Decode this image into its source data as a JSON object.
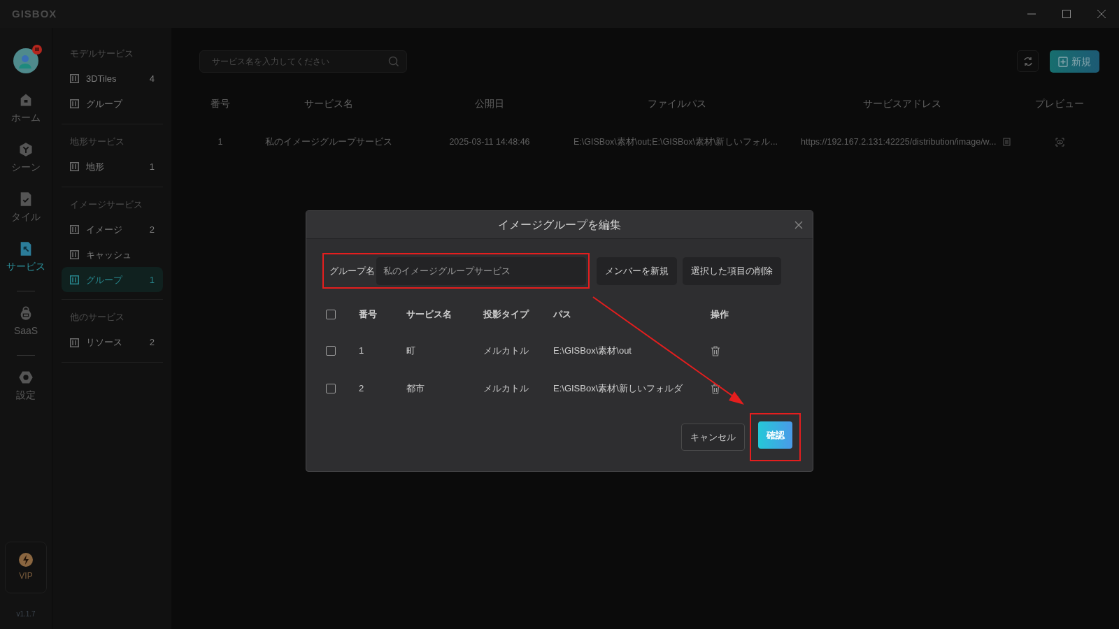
{
  "app": {
    "logo": "GISBOX",
    "version": "v1.1.7"
  },
  "nav_rail": [
    {
      "label": "ホーム",
      "selected": false
    },
    {
      "label": "シーン",
      "selected": false
    },
    {
      "label": "タイル",
      "selected": false
    },
    {
      "label": "サービス",
      "selected": true
    },
    {
      "label": "SaaS",
      "selected": false
    },
    {
      "label": "設定",
      "selected": false
    }
  ],
  "vip": {
    "label": "VIP"
  },
  "service_panel": {
    "sections": [
      {
        "title": "モデルサービス",
        "items": [
          {
            "label": "3DTiles",
            "count": "4",
            "selected": false
          },
          {
            "label": "グループ",
            "selected": false
          }
        ]
      },
      {
        "title": "地形サービス",
        "items": [
          {
            "label": "地形",
            "count": "1",
            "selected": false
          }
        ]
      },
      {
        "title": "イメージサービス",
        "items": [
          {
            "label": "イメージ",
            "count": "2",
            "selected": false
          },
          {
            "label": "キャッシュ",
            "selected": false
          },
          {
            "label": "グループ",
            "count": "1",
            "selected": true
          }
        ]
      },
      {
        "title": "他のサービス",
        "items": [
          {
            "label": "リソース",
            "count": "2",
            "selected": false
          }
        ]
      }
    ]
  },
  "search": {
    "placeholder": "サービス名を入力してください"
  },
  "new_button": {
    "label": "新規"
  },
  "table": {
    "columns": [
      "番号",
      "サービス名",
      "公開日",
      "ファイルパス",
      "サービスアドレス",
      "プレビュー"
    ],
    "rows": [
      {
        "cells": [
          "1",
          "私のイメージグループサービス",
          "2025-03-11 14:48:46",
          "E:\\GISBox\\素材\\out;E:\\GISBox\\素材\\新しいフォル...",
          "https://192.167.2.131:42225/distribution/image/w..."
        ]
      }
    ]
  },
  "dialog": {
    "title": "イメージグループを編集",
    "group_name": {
      "label": "グループ名",
      "value": "私のイメージグループサービス",
      "highlighted": true
    },
    "actions": [
      "メンバーを新規",
      "選択した項目の削除"
    ],
    "table": {
      "header_checked": false,
      "columns": [
        "番号",
        "サービス名",
        "投影タイプ",
        "パス",
        "操作"
      ],
      "rows": [
        {
          "checked": false,
          "cells": [
            "1",
            "町",
            "メルカトル",
            "E:\\GISBox\\素材\\out"
          ]
        },
        {
          "checked": false,
          "cells": [
            "2",
            "都市",
            "メルカトル",
            "E:\\GISBox\\素材\\新しいフォルダ"
          ]
        }
      ]
    },
    "footer": [
      {
        "label": "キャンセル",
        "kind": "secondary",
        "highlighted": false
      },
      {
        "label": "確認",
        "kind": "primary",
        "highlighted": true
      }
    ]
  }
}
